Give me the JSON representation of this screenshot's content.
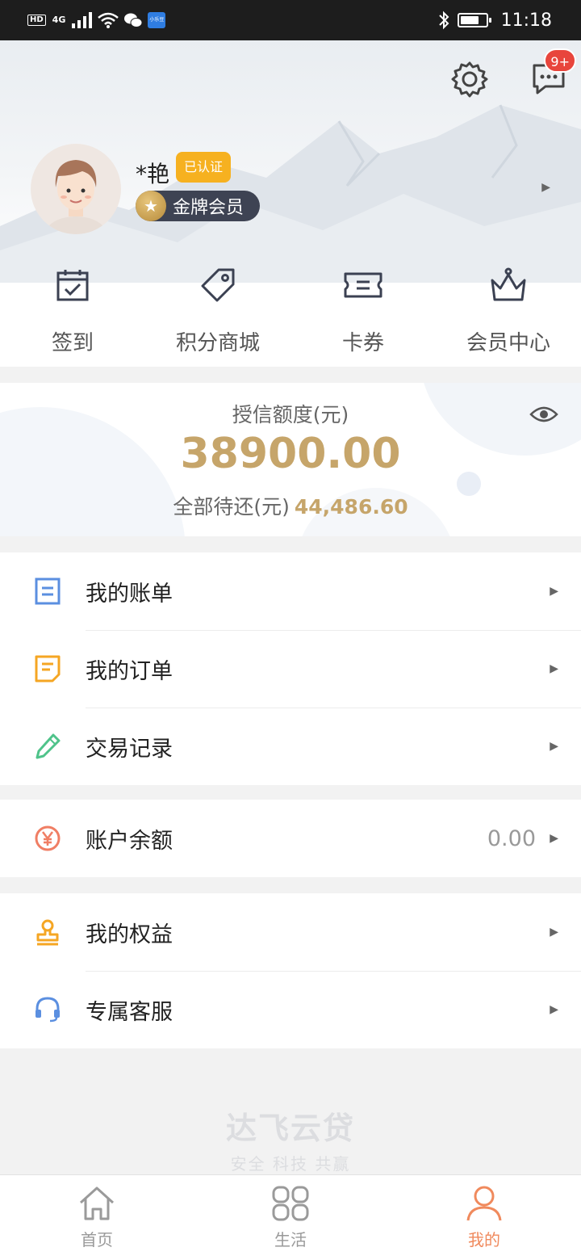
{
  "status_bar": {
    "left_tags": [
      "HD",
      "4G"
    ],
    "blue_app": "小乐豆",
    "time": "11:18"
  },
  "header": {
    "settings_icon": "gear-icon",
    "messages_icon": "chat-icon",
    "messages_badge": "9+",
    "user_name": "*艳",
    "verified_label": "已认证",
    "member_label": "金牌会员"
  },
  "quick_actions": [
    {
      "label": "签到",
      "icon": "calendar-check-icon"
    },
    {
      "label": "积分商城",
      "icon": "tag-icon"
    },
    {
      "label": "卡券",
      "icon": "ticket-icon"
    },
    {
      "label": "会员中心",
      "icon": "crown-icon"
    }
  ],
  "credit": {
    "label": "授信额度(元)",
    "amount": "38900.00",
    "pending_label": "全部待还(元)",
    "pending_value": "44,486.60"
  },
  "menu_group1": [
    {
      "label": "我的账单",
      "icon": "bill-icon",
      "color": "#5b8fe0"
    },
    {
      "label": "我的订单",
      "icon": "order-icon",
      "color": "#f5a623"
    },
    {
      "label": "交易记录",
      "icon": "pencil-icon",
      "color": "#4fc38a"
    }
  ],
  "menu_group2": [
    {
      "label": "账户余额",
      "icon": "yuan-icon",
      "value": "0.00",
      "color": "#f07e64"
    }
  ],
  "menu_group3": [
    {
      "label": "我的权益",
      "icon": "stamp-icon",
      "color": "#f5a623"
    },
    {
      "label": "专属客服",
      "icon": "headset-icon",
      "color": "#5b8fe0"
    }
  ],
  "brand": {
    "name": "达飞云贷",
    "slogan": "安全 科技 共赢"
  },
  "tabs": [
    {
      "label": "首页",
      "icon": "home-icon"
    },
    {
      "label": "生活",
      "icon": "grid-icon"
    },
    {
      "label": "我的",
      "icon": "person-icon"
    }
  ]
}
